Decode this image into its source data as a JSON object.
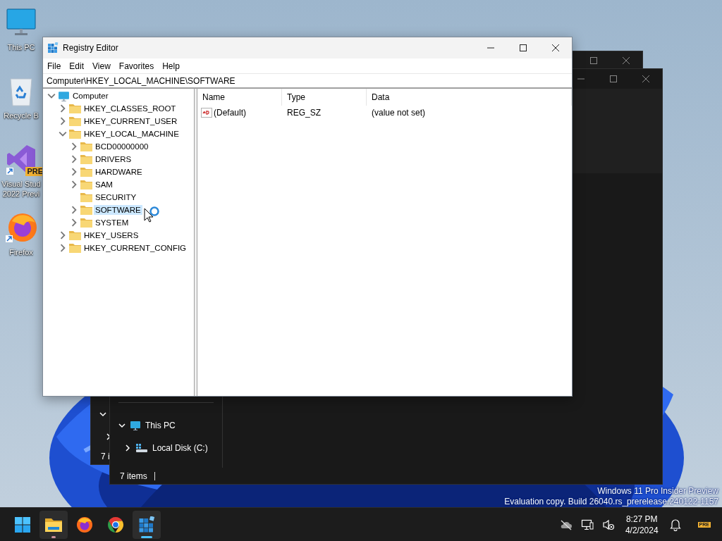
{
  "desktop_icons": [
    {
      "kind": "computer",
      "lines": [
        "This PC"
      ]
    },
    {
      "kind": "recycle-bin",
      "lines": [
        "Recycle B"
      ]
    },
    {
      "kind": "visual-studio",
      "badge": "PRE",
      "lines": [
        "Visual Stud",
        "2022 Previ"
      ]
    },
    {
      "kind": "firefox",
      "lines": [
        "Firefox"
      ]
    }
  ],
  "back_window": {
    "nav": [
      {
        "expanded": true
      },
      {
        "expanded": false
      }
    ],
    "status": "7 i"
  },
  "explorer_window": {
    "nav": [
      {
        "label": "This PC",
        "kind": "computer",
        "expanded": true,
        "children": [
          {
            "label": "Local Disk (C:)",
            "kind": "drive",
            "expanded": false
          }
        ]
      }
    ],
    "status": "7 items"
  },
  "registry_editor": {
    "title": "Registry Editor",
    "menu": [
      "File",
      "Edit",
      "View",
      "Favorites",
      "Help"
    ],
    "address": "Computer\\HKEY_LOCAL_MACHINE\\SOFTWARE",
    "tree": [
      {
        "label": "Computer",
        "kind": "computer",
        "expandable": true,
        "expanded": true,
        "selected": false,
        "children": [
          {
            "label": "HKEY_CLASSES_ROOT",
            "kind": "folder",
            "expandable": true,
            "expanded": false,
            "selected": false
          },
          {
            "label": "HKEY_CURRENT_USER",
            "kind": "folder",
            "expandable": true,
            "expanded": false,
            "selected": false
          },
          {
            "label": "HKEY_LOCAL_MACHINE",
            "kind": "folder",
            "expandable": true,
            "expanded": true,
            "selected": false,
            "children": [
              {
                "label": "BCD00000000",
                "kind": "folder",
                "expandable": true,
                "expanded": false,
                "selected": false
              },
              {
                "label": "DRIVERS",
                "kind": "folder",
                "expandable": true,
                "expanded": false,
                "selected": false
              },
              {
                "label": "HARDWARE",
                "kind": "folder",
                "expandable": true,
                "expanded": false,
                "selected": false
              },
              {
                "label": "SAM",
                "kind": "folder",
                "expandable": true,
                "expanded": false,
                "selected": false
              },
              {
                "label": "SECURITY",
                "kind": "folder",
                "expandable": false,
                "expanded": false,
                "selected": false
              },
              {
                "label": "SOFTWARE",
                "kind": "folder",
                "expandable": true,
                "expanded": false,
                "selected": true
              },
              {
                "label": "SYSTEM",
                "kind": "folder",
                "expandable": true,
                "expanded": false,
                "selected": false
              }
            ]
          },
          {
            "label": "HKEY_USERS",
            "kind": "folder",
            "expandable": true,
            "expanded": false,
            "selected": false
          },
          {
            "label": "HKEY_CURRENT_CONFIG",
            "kind": "folder",
            "expandable": true,
            "expanded": false,
            "selected": false
          }
        ]
      }
    ],
    "columns": [
      "Name",
      "Type",
      "Data"
    ],
    "values": [
      {
        "name": "(Default)",
        "type": "REG_SZ",
        "data": "(value not set)"
      }
    ]
  },
  "watermark": [
    "Windows 11 Pro Insider Preview",
    "Evaluation copy. Build 26040.rs_prerelease.240122-1157"
  ],
  "taskbar": {
    "apps": [
      {
        "kind": "start",
        "running": false,
        "selected": false
      },
      {
        "kind": "file-explorer",
        "running": true,
        "selected": false
      },
      {
        "kind": "firefox",
        "running": false,
        "selected": false
      },
      {
        "kind": "chrome",
        "running": false,
        "selected": false
      },
      {
        "kind": "registry-editor",
        "running": true,
        "selected": true
      }
    ],
    "tray": [
      {
        "kind": "cloud-off"
      },
      {
        "kind": "network"
      },
      {
        "kind": "volume-muted"
      }
    ],
    "time": "8:27 PM",
    "date": "4/2/2024",
    "badge": "PRE"
  }
}
